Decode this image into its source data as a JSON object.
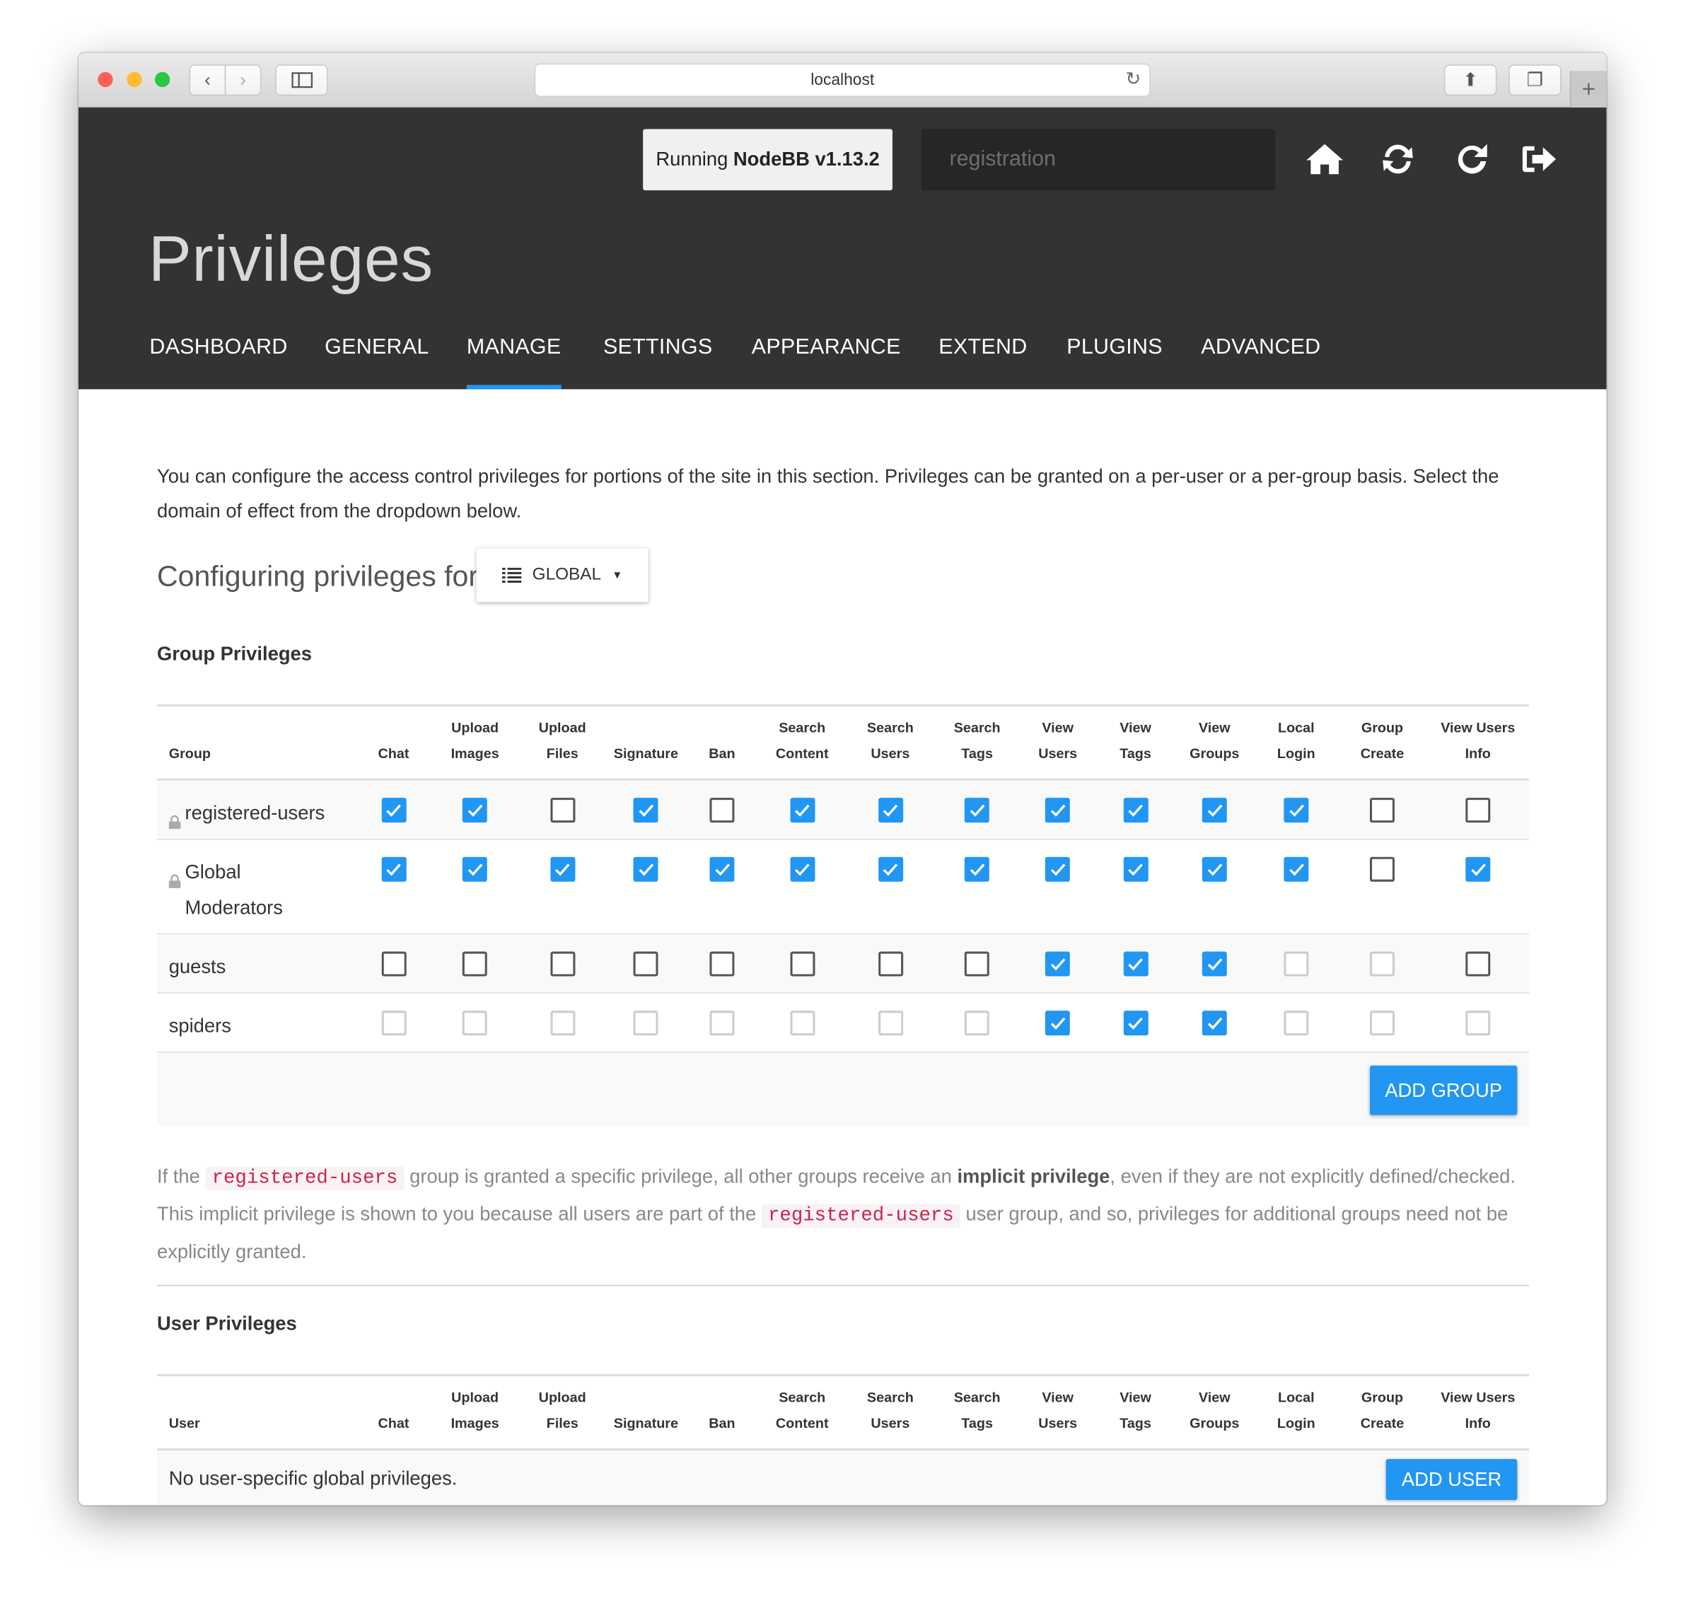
{
  "browser": {
    "url": "localhost",
    "traffic_colors": [
      "#fe5f57",
      "#febc2e",
      "#28c840"
    ]
  },
  "header": {
    "version_prefix": "Running",
    "version_name": "NodeBB v1.13.2",
    "search_placeholder": "registration",
    "icons": [
      "home-icon",
      "refresh-icon",
      "restart-icon",
      "logout-icon"
    ],
    "title": "Privileges",
    "nav": [
      {
        "label": "DASHBOARD"
      },
      {
        "label": "GENERAL"
      },
      {
        "label": "MANAGE",
        "active": true
      },
      {
        "label": "SETTINGS"
      },
      {
        "label": "APPEARANCE"
      },
      {
        "label": "EXTEND"
      },
      {
        "label": "PLUGINS"
      },
      {
        "label": "ADVANCED"
      }
    ]
  },
  "intro": "You can configure the access control privileges for portions of the site in this section. Privileges can be granted on a per-user or a per-group basis. Select the domain of effect from the dropdown below.",
  "config": {
    "label": "Configuring privileges for",
    "selected": "GLOBAL"
  },
  "columns": [
    [
      "",
      "Chat"
    ],
    [
      "Upload",
      "Images"
    ],
    [
      "Upload",
      "Files"
    ],
    [
      "",
      "Signature"
    ],
    [
      "",
      "Ban"
    ],
    [
      "Search",
      "Content"
    ],
    [
      "Search",
      "Users"
    ],
    [
      "Search",
      "Tags"
    ],
    [
      "View",
      "Users"
    ],
    [
      "View",
      "Tags"
    ],
    [
      "View",
      "Groups"
    ],
    [
      "Local",
      "Login"
    ],
    [
      "Group",
      "Create"
    ],
    [
      "View Users",
      "Info"
    ]
  ],
  "group_privileges": {
    "heading": "Group Privileges",
    "first_col": "Group",
    "rows": [
      {
        "name": "registered-users",
        "locked": true,
        "states": [
          "c",
          "c",
          "u",
          "c",
          "u",
          "c",
          "c",
          "c",
          "c",
          "c",
          "c",
          "c",
          "u",
          "u"
        ]
      },
      {
        "name": "Global Moderators",
        "locked": true,
        "states": [
          "c",
          "c",
          "c",
          "c",
          "c",
          "c",
          "c",
          "c",
          "c",
          "c",
          "c",
          "c",
          "u",
          "c"
        ]
      },
      {
        "name": "guests",
        "locked": false,
        "states": [
          "u",
          "u",
          "u",
          "u",
          "u",
          "u",
          "u",
          "u",
          "c",
          "c",
          "c",
          "d",
          "d",
          "u"
        ]
      },
      {
        "name": "spiders",
        "locked": false,
        "states": [
          "d",
          "d",
          "d",
          "d",
          "d",
          "d",
          "d",
          "d",
          "c",
          "c",
          "c",
          "d",
          "d",
          "d"
        ]
      }
    ],
    "add_label": "ADD GROUP"
  },
  "note": {
    "p1": "If the",
    "code": "registered-users",
    "p2": "group is granted a specific privilege, all other groups receive an",
    "bold": "implicit privilege",
    "p3": ", even if they are not explicitly defined/checked. This implicit privilege is shown to you because all users are part of the",
    "p4": "user group, and so, privileges for additional groups need not be explicitly granted."
  },
  "user_privileges": {
    "heading": "User Privileges",
    "first_col": "User",
    "empty": "No user-specific global privileges.",
    "add_label": "ADD USER"
  },
  "colors": {
    "accent": "#2196f3",
    "header_bg": "#333333"
  }
}
